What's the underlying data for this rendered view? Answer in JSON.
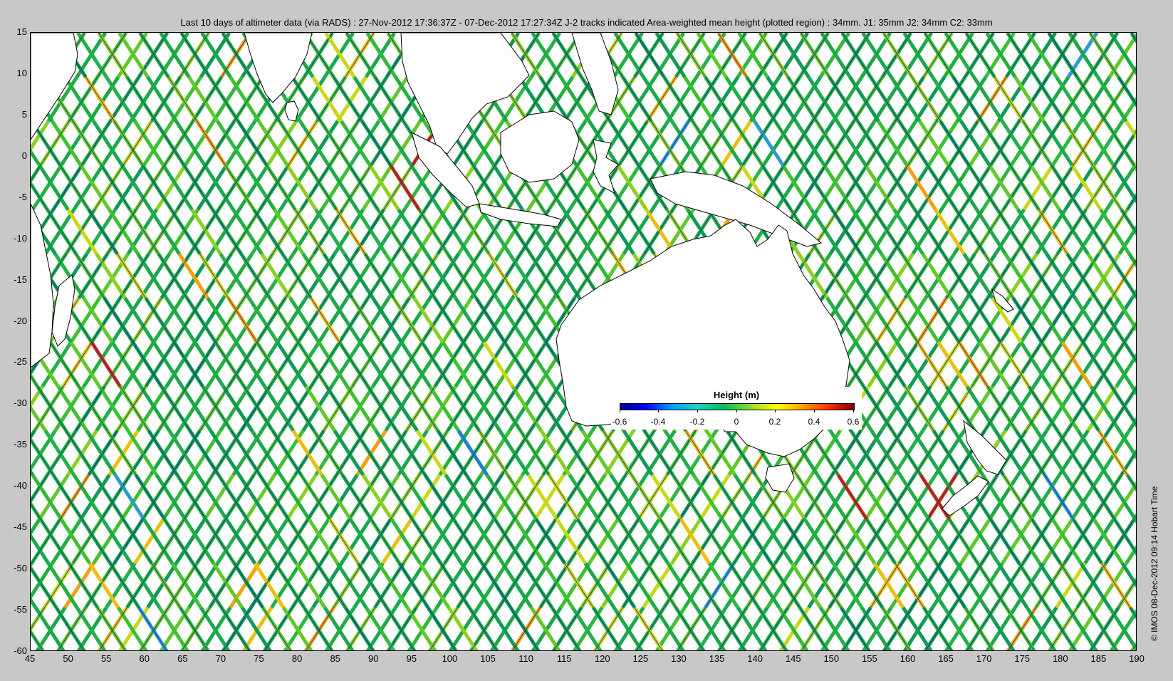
{
  "title": "Last 10 days of altimeter data (via RADS) : 27-Nov-2012 17:36:37Z - 07-Dec-2012 17:27:34Z  J-2 tracks indicated  Area-weighted mean height (plotted region) : 34mm.  J1: 35mm  J2: 34mm  C2: 33mm",
  "credit": "© IMOS 08-Dec-2012 09:14 Hobart Time",
  "axes": {
    "xlim": [
      45,
      190
    ],
    "ylim": [
      -60,
      15
    ],
    "x_ticks": [
      "45",
      "50",
      "55",
      "60",
      "65",
      "70",
      "75",
      "80",
      "85",
      "90",
      "95",
      "100",
      "105",
      "110",
      "115",
      "120",
      "125",
      "130",
      "135",
      "140",
      "145",
      "150",
      "155",
      "160",
      "165",
      "170",
      "175",
      "180",
      "185",
      "190"
    ],
    "y_ticks": [
      "15",
      "10",
      "5",
      "0",
      "-5",
      "-10",
      "-15",
      "-20",
      "-25",
      "-30",
      "-35",
      "-40",
      "-45",
      "-50",
      "-55",
      "-60"
    ]
  },
  "colorbar": {
    "title": "Height (m)",
    "ticks": [
      "-0.6",
      "-0.4",
      "-0.2",
      "0",
      "0.2",
      "0.4",
      "0.6"
    ],
    "range": [
      -0.6,
      0.6
    ],
    "colormap": "jet"
  },
  "map": {
    "land": [
      "India",
      "Sri Lanka",
      "Southeast Asia",
      "Borneo",
      "Sumatra",
      "Java",
      "Sulawesi",
      "New Guinea",
      "Australia",
      "Tasmania",
      "New Zealand",
      "Madagascar",
      "East Africa"
    ],
    "track_color_base": "#1aa84a",
    "jason2_track_line_color": "#1a2a7a"
  }
}
